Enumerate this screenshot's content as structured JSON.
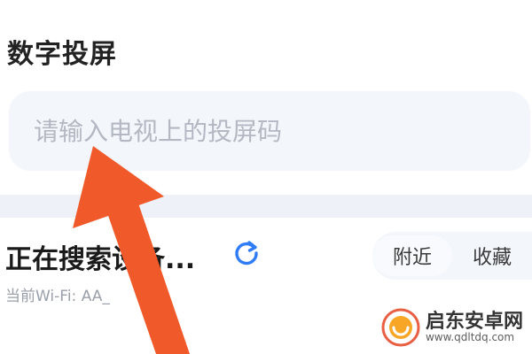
{
  "section": {
    "title": "数字投屏"
  },
  "code_input": {
    "placeholder": "请输入电视上的投屏码"
  },
  "search": {
    "status_text": "正在搜索设备...",
    "wifi_label": "当前Wi-Fi: AA_",
    "refresh_icon": "refresh-icon"
  },
  "tabs": [
    {
      "label": "附近"
    },
    {
      "label": "收藏"
    }
  ],
  "watermark": {
    "name": "启东安卓网",
    "url": "www.qdltdq.com"
  },
  "colors": {
    "accent": "#2f7cf6",
    "arrow": "#f05a2a",
    "input_bg": "#f3f6fb"
  }
}
